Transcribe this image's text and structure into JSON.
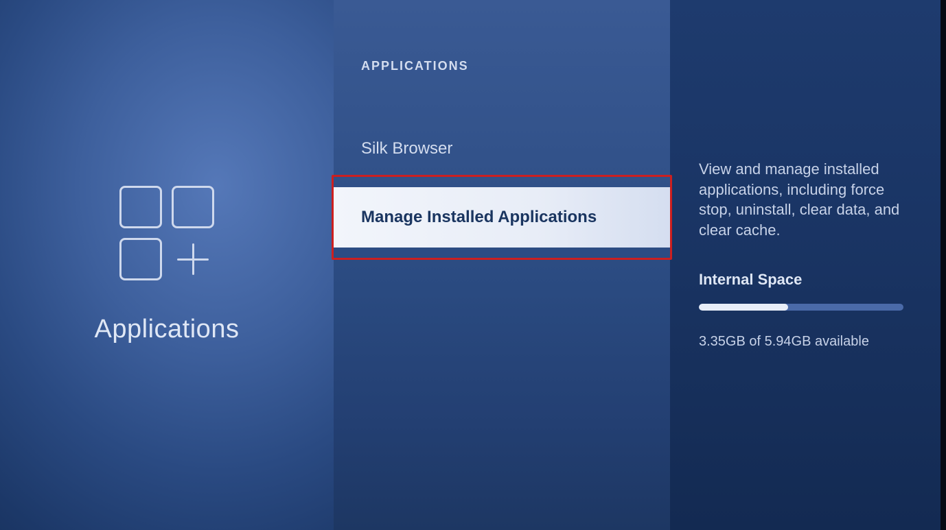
{
  "left": {
    "label": "Applications"
  },
  "middle": {
    "header": "APPLICATIONS",
    "items": [
      {
        "label": "Silk Browser",
        "selected": false
      },
      {
        "label": "Manage Installed Applications",
        "selected": true
      }
    ]
  },
  "right": {
    "description": "View and manage installed applications, including force stop, uninstall, clear data, and clear cache.",
    "storage_title": "Internal Space",
    "storage_text": "3.35GB of 5.94GB available",
    "storage_used_pct": 43.6
  }
}
